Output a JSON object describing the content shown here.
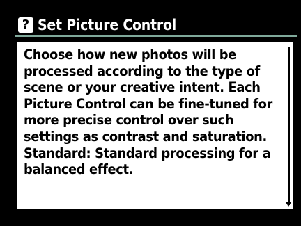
{
  "header": {
    "help_icon_glyph": "?",
    "title": "Set Picture Control"
  },
  "help": {
    "paragraph_1": "Choose how new photos will be processed according to the type of scene or your creative intent. Each Picture Control can be fine-tuned for more precise control over such settings as contrast and saturation.",
    "paragraph_2": "Standard: Standard processing for a balanced effect."
  },
  "colors": {
    "background": "#000000",
    "panel": "#ffffff",
    "underline": "#7fa89a"
  }
}
